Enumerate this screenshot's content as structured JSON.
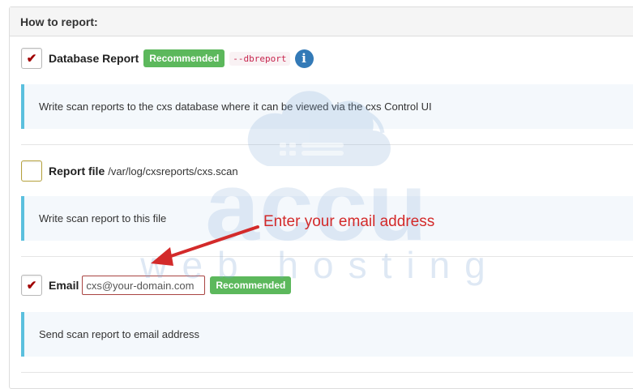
{
  "panel": {
    "title": "How to report:"
  },
  "db_report": {
    "checked": true,
    "label": "Database Report",
    "badge": "Recommended",
    "flag": "--dbreport",
    "info_icon": "i",
    "description": "Write scan reports to the cxs database where it can be viewed via the cxs Control UI"
  },
  "report_file": {
    "checked": false,
    "label": "Report file",
    "path": "/var/log/cxsreports/cxs.scan",
    "description": "Write scan report to this file"
  },
  "email": {
    "checked": true,
    "label": "Email",
    "value": "cxs@your-domain.com",
    "badge": "Recommended",
    "description": "Send scan report to email address"
  },
  "annotation": {
    "text": "Enter your email address"
  },
  "watermark": {
    "line1": "accu",
    "line2": "web hosting"
  },
  "colors": {
    "badge": "#5cb85c",
    "info": "#337ab7",
    "annotation": "#d32a2a",
    "desc_border": "#5bc0de"
  }
}
